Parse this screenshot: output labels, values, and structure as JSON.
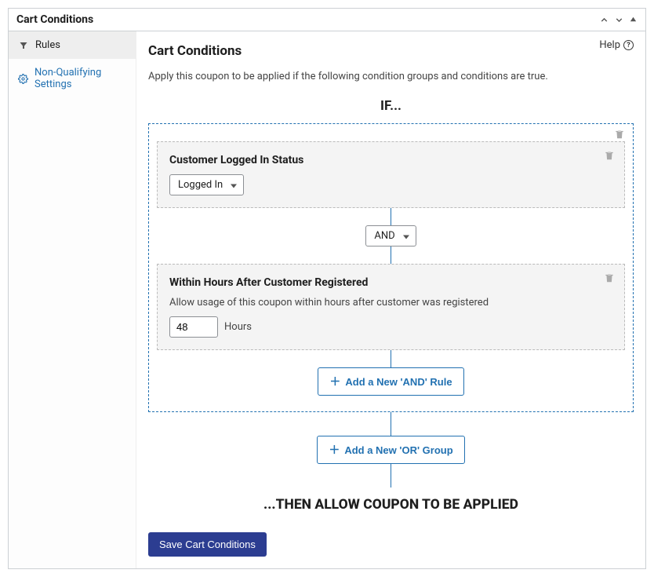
{
  "panel": {
    "title": "Cart Conditions"
  },
  "sidebar": {
    "items": [
      {
        "label": "Rules",
        "icon": "filter-icon"
      },
      {
        "label": "Non-Qualifying Settings",
        "icon": "gear-icon"
      }
    ]
  },
  "help": {
    "label": "Help"
  },
  "main": {
    "heading": "Cart Conditions",
    "subtitle": "Apply this coupon to be applied if the following condition groups and conditions are true.",
    "if_label": "IF...",
    "then_label": "...THEN ALLOW COUPON TO BE APPLIED",
    "group": {
      "rules": [
        {
          "title": "Customer Logged In Status",
          "select_value": "Logged In"
        },
        {
          "title": "Within Hours After Customer Registered",
          "desc": "Allow usage of this coupon within hours after customer was registered",
          "input_value": "48",
          "input_suffix": "Hours"
        }
      ],
      "connector_value": "AND"
    },
    "add_and_label": "Add a New 'AND' Rule",
    "add_or_label": "Add a New 'OR' Group",
    "save_label": "Save Cart Conditions"
  }
}
